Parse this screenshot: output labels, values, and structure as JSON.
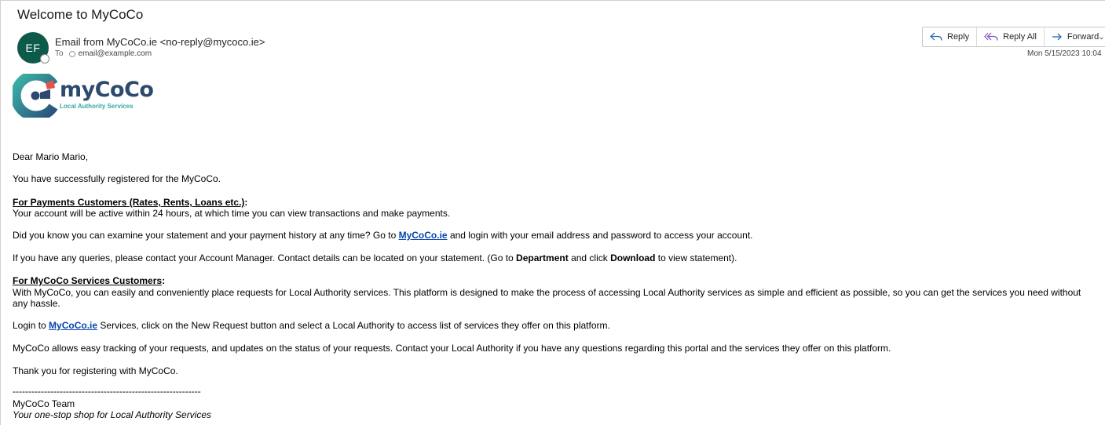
{
  "email": {
    "subject": "Welcome to MyCoCo",
    "avatar_initials": "EF",
    "from": "Email from MyCoCo.ie <no-reply@mycoco.ie>",
    "to_label": "To",
    "to_address": "email@example.com",
    "date": "Mon 5/15/2023 10:04"
  },
  "actions": {
    "reply": "Reply",
    "reply_all": "Reply All",
    "forward": "Forward"
  },
  "logo": {
    "name": "myCoCo",
    "subtitle": "Local Authority Services"
  },
  "body": {
    "greeting": "Dear Mario Mario,",
    "registered": "You have successfully registered for the MyCoCo.",
    "payments_heading": "For Payments Customers (Rates, Rents, Loans etc.)",
    "payments_colon": ":",
    "payments_text": "Your account will be active within 24 hours, at which time you can view transactions and make payments.",
    "statement_pre": "Did you know you can examine your statement and your payment history at any time? Go to ",
    "statement_link": "MyCoCo.ie",
    "statement_post": " and login with your email address and password to access your account.",
    "queries_pre": "If you have any queries, please contact your Account Manager. Contact details can be located on your statement. (Go to ",
    "queries_dept": "Department",
    "queries_mid": " and click ",
    "queries_download": "Download",
    "queries_post": " to view statement).",
    "services_heading": "For MyCoCo Services Customers",
    "services_colon": ":",
    "services_text": "With MyCoCo, you can easily and conveniently place requests for Local Authority services. This platform is designed to make the process of accessing Local Authority services as simple and efficient as possible, so you can get the services you need without any hassle.",
    "login_pre": "Login to ",
    "login_link": "MyCoCo.ie",
    "login_post": " Services, click on the New Request button and select a Local Authority to access list of services they offer on this platform.",
    "tracking": "MyCoCo allows easy tracking of your requests, and updates on the status of your requests. Contact your Local Authority if you have any questions regarding this portal and the services they offer on this platform.",
    "thanks": "Thank you for registering with MyCoCo.",
    "divider": "------------------------------------------------------------",
    "signature": "MyCoCo Team",
    "tagline": "Your one-stop shop for Local Authority Services"
  },
  "colors": {
    "avatar": "#0e5a4a",
    "link": "#0645ad",
    "logo_navy": "#2d4a6e",
    "logo_teal": "#37a7a0",
    "icon_blue": "#2b6cb0",
    "icon_purple": "#8a5cc0"
  }
}
